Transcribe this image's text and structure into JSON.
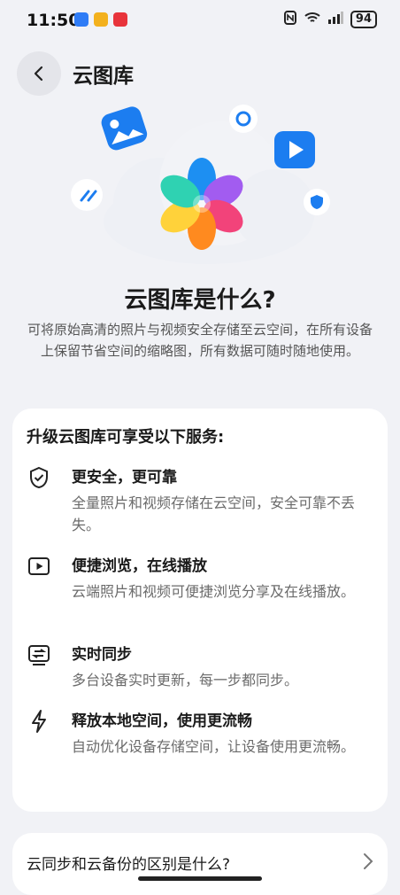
{
  "status_bar": {
    "time": "11:50",
    "battery": "94"
  },
  "header": {
    "title": "云图库"
  },
  "hero": {
    "headline": "云图库是什么?",
    "intro": "可将原始高清的照片与视频安全存储至云空间，在所有设备上保留节省空间的缩略图，所有数据可随时随地使用。"
  },
  "card": {
    "title": "升级云图库可享受以下服务:",
    "features": [
      {
        "icon": "shield-check-icon",
        "title": "更安全，更可靠",
        "desc": "全量照片和视频存储在云空间，安全可靠不丢失。"
      },
      {
        "icon": "play-icon",
        "title": "便捷浏览，在线播放",
        "desc": "云端照片和视频可便捷浏览分享及在线播放。"
      },
      {
        "icon": "sync-icon",
        "title": "实时同步",
        "desc": "多台设备实时更新，每一步都同步。"
      },
      {
        "icon": "lightning-icon",
        "title": "释放本地空间，使用更流畅",
        "desc": "自动优化设备存储空间，让设备使用更流畅。"
      }
    ]
  },
  "faq": {
    "label": "云同步和云备份的区别是什么?"
  },
  "colors": {
    "accent": "#1a73e8",
    "background": "#f1f2f6"
  }
}
